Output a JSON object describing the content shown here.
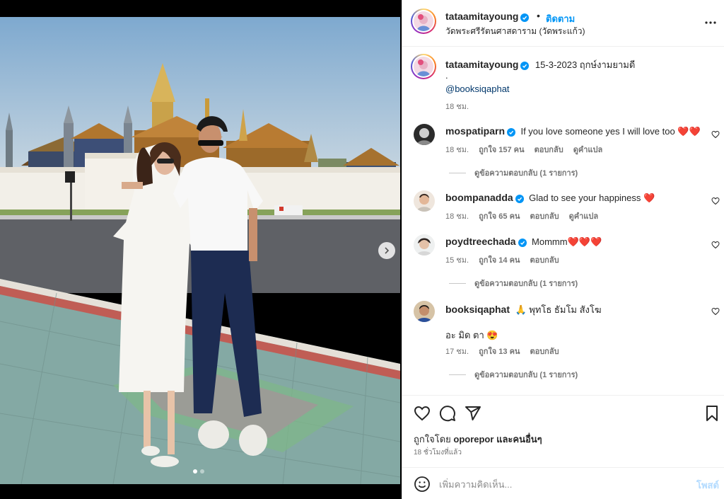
{
  "post": {
    "username": "tataamitayoung",
    "follow_label": "ติดตาม",
    "dot": "•",
    "location": "วัดพระศรีรัตนศาสดาราม (วัดพระแก้ว)"
  },
  "caption": {
    "username": "tataamitayoung",
    "text": "15-3-2023 ฤกษ์งามยามดี",
    "dot_line": ".",
    "mention": "@booksiqaphat",
    "time": "18 ชม."
  },
  "comments": [
    {
      "username": "mospatiparn",
      "verified": true,
      "text": "If you love someone yes I will love too ❤️❤️",
      "time": "18 ชม.",
      "likes": "ถูกใจ 157 คน",
      "reply": "ตอบกลับ",
      "translate": "ดูคำแปล",
      "view_replies": "ดูข้อความตอบกลับ (1 รายการ)"
    },
    {
      "username": "boompanadda",
      "verified": true,
      "text": "Glad to see your happiness ❤️",
      "time": "18 ชม.",
      "likes": "ถูกใจ 65 คน",
      "reply": "ตอบกลับ",
      "translate": "ดูคำแปล"
    },
    {
      "username": "poydtreechada",
      "verified": true,
      "text": "Mommm❤️❤️❤️",
      "time": "15 ชม.",
      "likes": "ถูกใจ 14 คน",
      "reply": "ตอบกลับ",
      "view_replies": "ดูข้อความตอบกลับ (1 รายการ)"
    },
    {
      "username": "booksiqaphat",
      "verified": false,
      "text": "🙏 พุทโธ ธัมโม สังโฆ",
      "text2": "อะ มิด ตา 😍",
      "time": "17 ชม.",
      "likes": "ถูกใจ 13 คน",
      "reply": "ตอบกลับ",
      "view_replies": "ดูข้อความตอบกลับ (1 รายการ)"
    }
  ],
  "footer": {
    "liked_prefix": "ถูกใจโดย",
    "liked_user": "oporepor",
    "liked_suffix": "และคนอื่นๆ",
    "time_ago": "18 ชั่วโมงที่แล้ว",
    "comment_placeholder": "เพิ่มความคิดเห็น...",
    "post_label": "โพสต์"
  },
  "icons": {
    "header_more": "more-horizontal-icon",
    "like": "heart-icon",
    "comment": "comment-icon",
    "share": "send-icon",
    "save": "bookmark-icon",
    "emoji": "emoji-icon",
    "next": "chevron-right-icon"
  },
  "colors": {
    "link": "#0095f6",
    "mention": "#00376b",
    "verified": "#0095f6",
    "post_disabled": "#b3dbff",
    "secondary_text": "#737373"
  }
}
